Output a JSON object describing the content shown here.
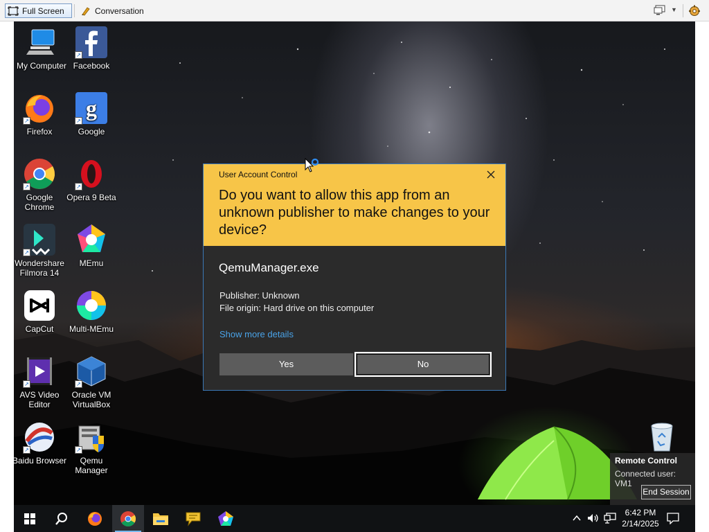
{
  "toolbar": {
    "fullscreen_label": "Full Screen",
    "conversation_label": "Conversation"
  },
  "desktop": {
    "icons": [
      {
        "label": "My Computer",
        "icon": "computer-icon"
      },
      {
        "label": "Facebook",
        "icon": "facebook-icon"
      },
      {
        "label": "Firefox",
        "icon": "firefox-icon"
      },
      {
        "label": "Google",
        "icon": "google-icon"
      },
      {
        "label": "Google Chrome",
        "icon": "chrome-icon"
      },
      {
        "label": "Opera 9 Beta",
        "icon": "opera-icon"
      },
      {
        "label": "Wondershare Filmora 14",
        "icon": "filmora-icon"
      },
      {
        "label": "MEmu",
        "icon": "memu-icon"
      },
      {
        "label": "CapCut",
        "icon": "capcut-icon"
      },
      {
        "label": "Multi-MEmu",
        "icon": "multi-memu-icon"
      },
      {
        "label": "AVS Video Editor",
        "icon": "avs-video-icon"
      },
      {
        "label": "Oracle VM VirtualBox",
        "icon": "virtualbox-icon"
      },
      {
        "label": "Baidu Browser",
        "icon": "baidu-icon"
      },
      {
        "label": "Qemu Manager",
        "icon": "qemu-icon"
      }
    ]
  },
  "uac": {
    "title": "User Account Control",
    "question": "Do you want to allow this app from an unknown publisher to make changes to your device?",
    "app_name": "QemuManager.exe",
    "publisher": "Publisher: Unknown",
    "origin": "File origin: Hard drive on this computer",
    "more_details": "Show more details",
    "yes_label": "Yes",
    "no_label": "No",
    "header_color": "#f7c548",
    "body_color": "#2b2b2b"
  },
  "remote_control": {
    "title": "Remote Control",
    "user": "Connected user: VM1",
    "end_label": "End Session"
  },
  "taskbar": {
    "items": [
      "start-icon",
      "search-icon",
      "firefox-icon",
      "chrome-icon",
      "file-explorer-icon",
      "chat-icon",
      "memu-icon"
    ],
    "active_item": "chrome-icon",
    "time": "6:42 PM",
    "date": "2/14/2025"
  }
}
